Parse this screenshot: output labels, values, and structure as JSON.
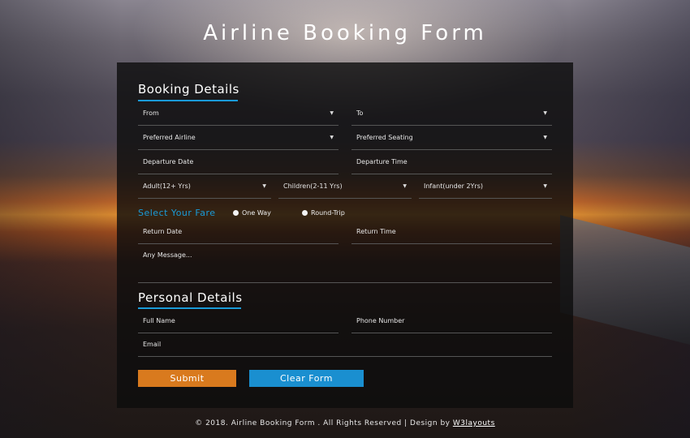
{
  "page": {
    "title": "Airline Booking Form"
  },
  "booking": {
    "heading": "Booking Details",
    "from": "From",
    "to": "To",
    "preferred_airline": "Preferred Airline",
    "preferred_seating": "Preferred Seating",
    "departure_date": "Departure Date",
    "departure_time": "Departure Time",
    "adult": "Adult(12+ Yrs)",
    "children": "Children(2-11 Yrs)",
    "infant": "Infant(under 2Yrs)",
    "fare_label": "Select Your Fare",
    "fare_options": [
      "One Way",
      "Round-Trip"
    ],
    "return_date": "Return Date",
    "return_time": "Return Time",
    "message": "Any Message..."
  },
  "personal": {
    "heading": "Personal Details",
    "full_name": "Full Name",
    "phone": "Phone Number",
    "email": "Email"
  },
  "buttons": {
    "submit": "Submit",
    "clear": "Clear Form"
  },
  "footer": {
    "text": "© 2018. Airline Booking Form . All Rights Reserved | Design by",
    "link": "W3layouts"
  },
  "icons": {
    "dropdown": "chevron-down-icon"
  },
  "colors": {
    "accent": "#1a9bd8",
    "submit": "#d97a1e",
    "clear": "#1a8fd0"
  }
}
